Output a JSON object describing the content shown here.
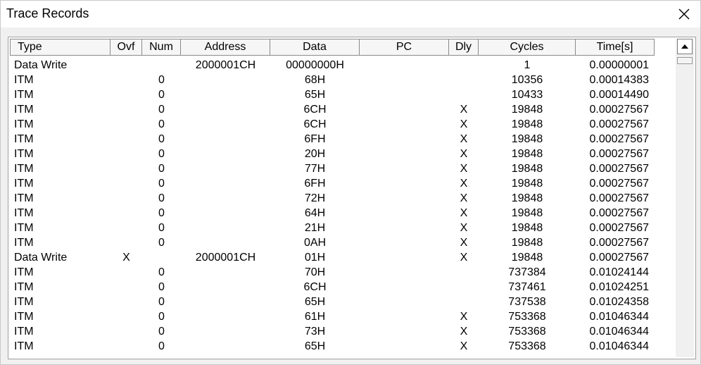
{
  "window": {
    "title": "Trace Records"
  },
  "columns": [
    "Type",
    "Ovf",
    "Num",
    "Address",
    "Data",
    "PC",
    "Dly",
    "Cycles",
    "Time[s]"
  ],
  "rows": [
    [
      "Data Write",
      "",
      "",
      "2000001CH",
      "00000000H",
      "",
      "",
      "1",
      "0.00000001"
    ],
    [
      "ITM",
      "",
      "0",
      "",
      "68H",
      "",
      "",
      "10356",
      "0.00014383"
    ],
    [
      "ITM",
      "",
      "0",
      "",
      "65H",
      "",
      "",
      "10433",
      "0.00014490"
    ],
    [
      "ITM",
      "",
      "0",
      "",
      "6CH",
      "",
      "X",
      "19848",
      "0.00027567"
    ],
    [
      "ITM",
      "",
      "0",
      "",
      "6CH",
      "",
      "X",
      "19848",
      "0.00027567"
    ],
    [
      "ITM",
      "",
      "0",
      "",
      "6FH",
      "",
      "X",
      "19848",
      "0.00027567"
    ],
    [
      "ITM",
      "",
      "0",
      "",
      "20H",
      "",
      "X",
      "19848",
      "0.00027567"
    ],
    [
      "ITM",
      "",
      "0",
      "",
      "77H",
      "",
      "X",
      "19848",
      "0.00027567"
    ],
    [
      "ITM",
      "",
      "0",
      "",
      "6FH",
      "",
      "X",
      "19848",
      "0.00027567"
    ],
    [
      "ITM",
      "",
      "0",
      "",
      "72H",
      "",
      "X",
      "19848",
      "0.00027567"
    ],
    [
      "ITM",
      "",
      "0",
      "",
      "64H",
      "",
      "X",
      "19848",
      "0.00027567"
    ],
    [
      "ITM",
      "",
      "0",
      "",
      "21H",
      "",
      "X",
      "19848",
      "0.00027567"
    ],
    [
      "ITM",
      "",
      "0",
      "",
      "0AH",
      "",
      "X",
      "19848",
      "0.00027567"
    ],
    [
      "Data Write",
      "X",
      "",
      "2000001CH",
      "01H",
      "",
      "X",
      "19848",
      "0.00027567"
    ],
    [
      "ITM",
      "",
      "0",
      "",
      "70H",
      "",
      "",
      "737384",
      "0.01024144"
    ],
    [
      "ITM",
      "",
      "0",
      "",
      "6CH",
      "",
      "",
      "737461",
      "0.01024251"
    ],
    [
      "ITM",
      "",
      "0",
      "",
      "65H",
      "",
      "",
      "737538",
      "0.01024358"
    ],
    [
      "ITM",
      "",
      "0",
      "",
      "61H",
      "",
      "X",
      "753368",
      "0.01046344"
    ],
    [
      "ITM",
      "",
      "0",
      "",
      "73H",
      "",
      "X",
      "753368",
      "0.01046344"
    ],
    [
      "ITM",
      "",
      "0",
      "",
      "65H",
      "",
      "X",
      "753368",
      "0.01046344"
    ]
  ],
  "icons": {
    "close": "close-icon",
    "scroll_up": "arrow-up-icon"
  }
}
